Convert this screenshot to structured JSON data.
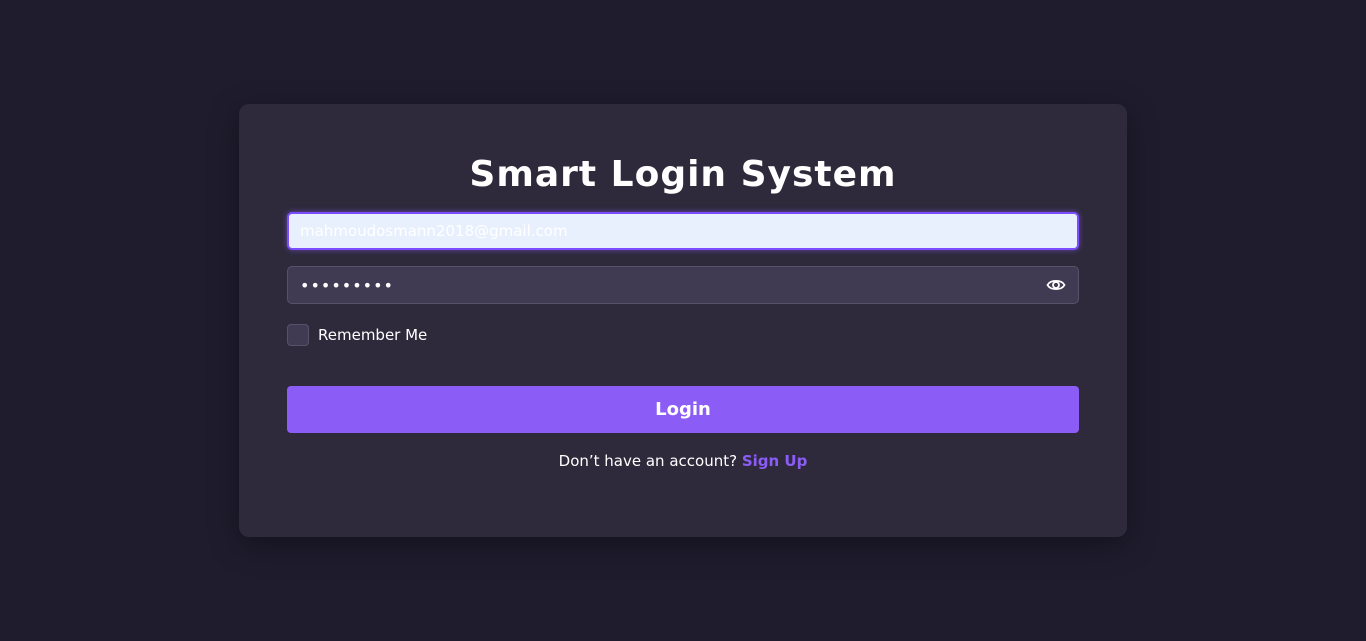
{
  "login_form": {
    "title": "Smart Login System",
    "email": {
      "value": "mahmoudosmann2018@gmail.com"
    },
    "password": {
      "value": "123456789",
      "icon": "eye-icon"
    },
    "remember_me": {
      "label": "Remember Me",
      "checked": false
    },
    "login_button": "Login",
    "signup_prompt": "Don’t have an account?",
    "signup_link": "Sign Up"
  },
  "colors": {
    "page_background": "#1f1c2d",
    "card_background": "#2e2a3b",
    "accent": "#8b5cf6",
    "input_background": "#403b52",
    "autofill_background": "#e8f0fe"
  }
}
